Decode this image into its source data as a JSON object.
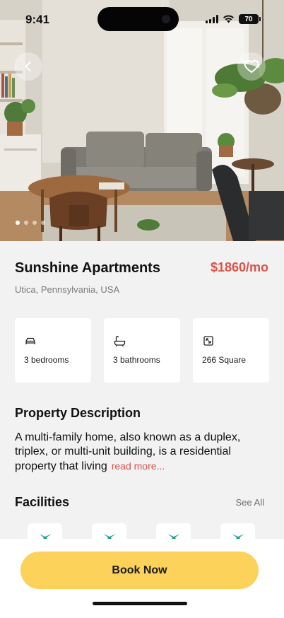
{
  "status_bar": {
    "time": "9:41",
    "battery": "70"
  },
  "hero": {
    "slide_count": 4,
    "active_slide": 0
  },
  "property": {
    "name": "Sunshine Apartments",
    "price": "$1860/mo",
    "location": "Utica, Pennsylvania, USA"
  },
  "features": [
    {
      "icon": "bed-icon",
      "label": "3 bedrooms"
    },
    {
      "icon": "bathtub-icon",
      "label": "3 bathrooms"
    },
    {
      "icon": "area-icon",
      "label": "266 Square"
    }
  ],
  "description": {
    "title": "Property Description",
    "text": "A multi-family home, also known as a duplex, triplex, or multi-unit building, is a residential property that living",
    "read_more": "read more..."
  },
  "facilities": {
    "title": "Facilities",
    "see_all": "See All",
    "items": [
      {
        "icon": "facility-icon"
      },
      {
        "icon": "facility-icon"
      },
      {
        "icon": "facility-icon"
      },
      {
        "icon": "facility-icon"
      }
    ]
  },
  "actions": {
    "book_label": "Book Now"
  },
  "colors": {
    "accent": "#d9534a",
    "button": "#fcd25a",
    "facility_icon": "#1f9a8e"
  }
}
